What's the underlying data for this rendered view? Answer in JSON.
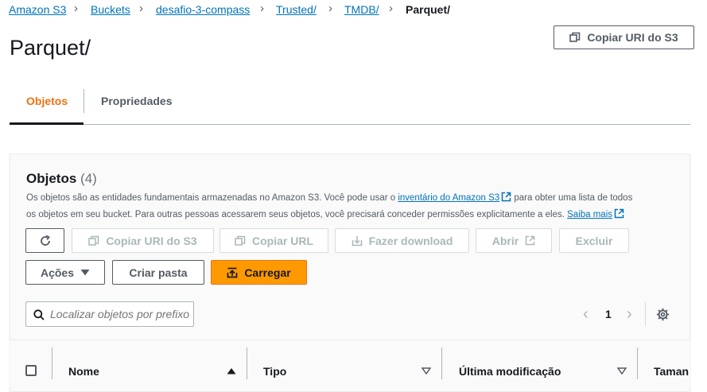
{
  "breadcrumb": {
    "items": [
      "Amazon S3",
      "Buckets",
      "desafio-3-compass",
      "Trusted/",
      "TMDB/"
    ],
    "current": "Parquet/"
  },
  "header": {
    "title": "Parquet/",
    "copy_uri_label": "Copiar URI do S3"
  },
  "tabs": [
    {
      "label": "Objetos",
      "active": true
    },
    {
      "label": "Propriedades",
      "active": false
    }
  ],
  "objects_panel": {
    "title": "Objetos",
    "count": "(4)",
    "description_line1_pre": "Os objetos são as entidades fundamentais armazenadas no Amazon S3. Você pode usar o ",
    "description_link": "inventário do Amazon S3",
    "description_line1_post": " para obter uma lista de todos",
    "description_line2": "os objetos em seu bucket. Para outras pessoas acessarem seus objetos, você precisará conceder permissões explicitamente a eles. ",
    "learn_more": "Saiba mais",
    "toolbar": {
      "copy_uri": "Copiar URI do S3",
      "copy_url": "Copiar URL",
      "download": "Fazer download",
      "open": "Abrir",
      "delete": "Excluir",
      "actions": "Ações",
      "create_folder": "Criar pasta",
      "upload": "Carregar"
    },
    "search": {
      "placeholder": "Localizar objetos por prefixo"
    },
    "pagination": {
      "page": "1"
    },
    "table": {
      "columns": [
        "Nome",
        "Tipo",
        "Última modificação",
        "Taman"
      ]
    }
  },
  "colors": {
    "link": "#0073bb",
    "accent": "#ec7211",
    "primary_button": "#ff9900"
  }
}
